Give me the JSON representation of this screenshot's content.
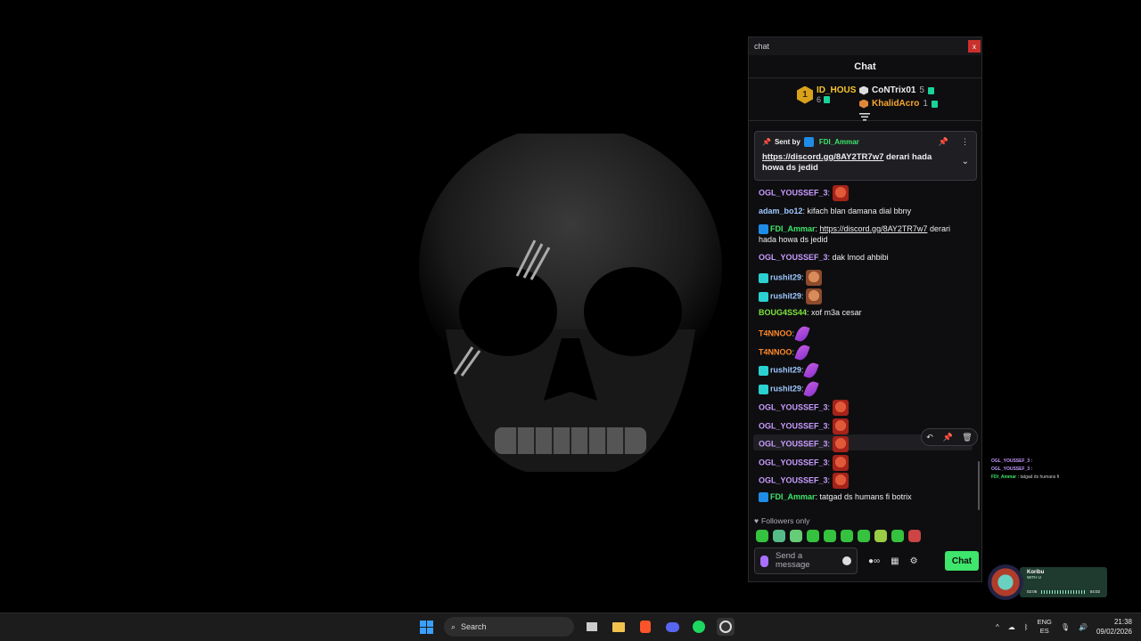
{
  "window": {
    "title": "chat",
    "close_label": "x"
  },
  "chat": {
    "header": "Chat",
    "leaderboard": {
      "first": {
        "rank": "1",
        "name": "ID_HOUS",
        "score": "6"
      },
      "others": [
        {
          "name": "CoNTrix01",
          "score": "5",
          "color": "#efeff1"
        },
        {
          "name": "KhalidAcro",
          "score": "1",
          "color": "#f7a531"
        }
      ]
    },
    "pinned": {
      "sent_by_label": "Sent by",
      "author": "FDI_Ammar",
      "link": "https://discord.gg/8AY2TR7w7",
      "text": " derari hada howa ds jedid"
    },
    "messages": [
      {
        "user": "OGL_YOUSSEF_3",
        "color": "#c89cff",
        "text": "",
        "emote": "face-red"
      },
      {
        "user": "adam_bo12",
        "color": "#9ec8ff",
        "text": "kifach blan damana dial bbny"
      },
      {
        "user": "FDI_Ammar",
        "color": "#3ee66b",
        "link": "https://discord.gg/8AY2TR7w7",
        "text": " derari hada howa ds jedid",
        "badge": "blue"
      },
      {
        "user": "OGL_YOUSSEF_3",
        "color": "#c89cff",
        "text": "dak lmod ahbibi"
      },
      {
        "user": "rushit29",
        "color": "#9ec8ff",
        "text": "",
        "emote": "face-orange",
        "badge": "cyan"
      },
      {
        "user": "rushit29",
        "color": "#9ec8ff",
        "text": "",
        "emote": "face-orange",
        "badge": "cyan"
      },
      {
        "user": "BOUG4SS44",
        "color": "#7ce33e",
        "text": "xof m3a cesar"
      },
      {
        "user": "T4NNOO",
        "color": "#ff8a2a",
        "text": "",
        "emote": "feather"
      },
      {
        "user": "T4NNOO",
        "color": "#ff8a2a",
        "text": "",
        "emote": "feather"
      },
      {
        "user": "rushit29",
        "color": "#9ec8ff",
        "text": "",
        "emote": "feather",
        "badge": "cyan"
      },
      {
        "user": "rushit29",
        "color": "#9ec8ff",
        "text": "",
        "emote": "feather",
        "badge": "cyan"
      },
      {
        "user": "OGL_YOUSSEF_3",
        "color": "#c89cff",
        "text": "",
        "emote": "face-red"
      },
      {
        "user": "OGL_YOUSSEF_3",
        "color": "#c89cff",
        "text": "",
        "emote": "face-red"
      },
      {
        "user": "OGL_YOUSSEF_3",
        "color": "#c89cff",
        "text": "",
        "emote": "face-red"
      },
      {
        "user": "OGL_YOUSSEF_3",
        "color": "#c89cff",
        "text": "",
        "emote": "face-red"
      },
      {
        "user": "OGL_YOUSSEF_3",
        "color": "#c89cff",
        "text": "",
        "emote": "face-red"
      },
      {
        "user": "FDI_Ammar",
        "color": "#3ee66b",
        "text": "tatgad ds humans fi botrix",
        "badge": "blue"
      }
    ],
    "followers_only": "Followers only",
    "input_placeholder": "Send a message",
    "send_label": "Chat"
  },
  "mini_chat": [
    {
      "user": "OGL_YOUSSEF_3 :",
      "text": ""
    },
    {
      "user": "OGL_YOUSSEF_3 :",
      "text": ""
    },
    {
      "user": "FDI_Ammar :",
      "text": "tatgad ds humans fi"
    }
  ],
  "media": {
    "title": "Koribu",
    "artist": "WITH U",
    "elapsed": "02:06",
    "total": "04:02"
  },
  "taskbar": {
    "search_label": "Search",
    "lang_top": "ENG",
    "lang_bottom": "ES",
    "time": "21:38",
    "date": "09/02/2026"
  }
}
